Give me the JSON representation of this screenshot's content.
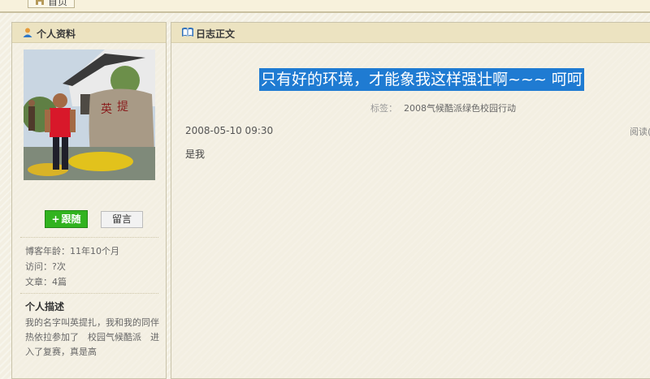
{
  "nav": {
    "home_label": "首页"
  },
  "sidebar": {
    "profile_title": "个人资料",
    "follow_label": "跟随",
    "message_label": "留言",
    "blog_age": "博客年龄：11年10个月",
    "visits": "访问：?次",
    "articles": "文章：4篇",
    "description_title": "个人描述",
    "description_text": "我的名字叫英提扎，我和我的同伴热依拉参加了　校园气候酷派　进入了复赛，真是高"
  },
  "main": {
    "panel_title": "日志正文",
    "post_title": "只有好的环境，才能象我这样强壮啊~~~ 呵呵",
    "tags_label": "标签：",
    "tags_value": "2008气候酷派绿色校园行动",
    "date": "2008-05-10 09:30",
    "reads_label": "阅读(",
    "body": "是我"
  },
  "colors": {
    "highlight": "#1f7bd2",
    "follow_button": "#31b31f",
    "panel_header": "#ece3c1"
  }
}
